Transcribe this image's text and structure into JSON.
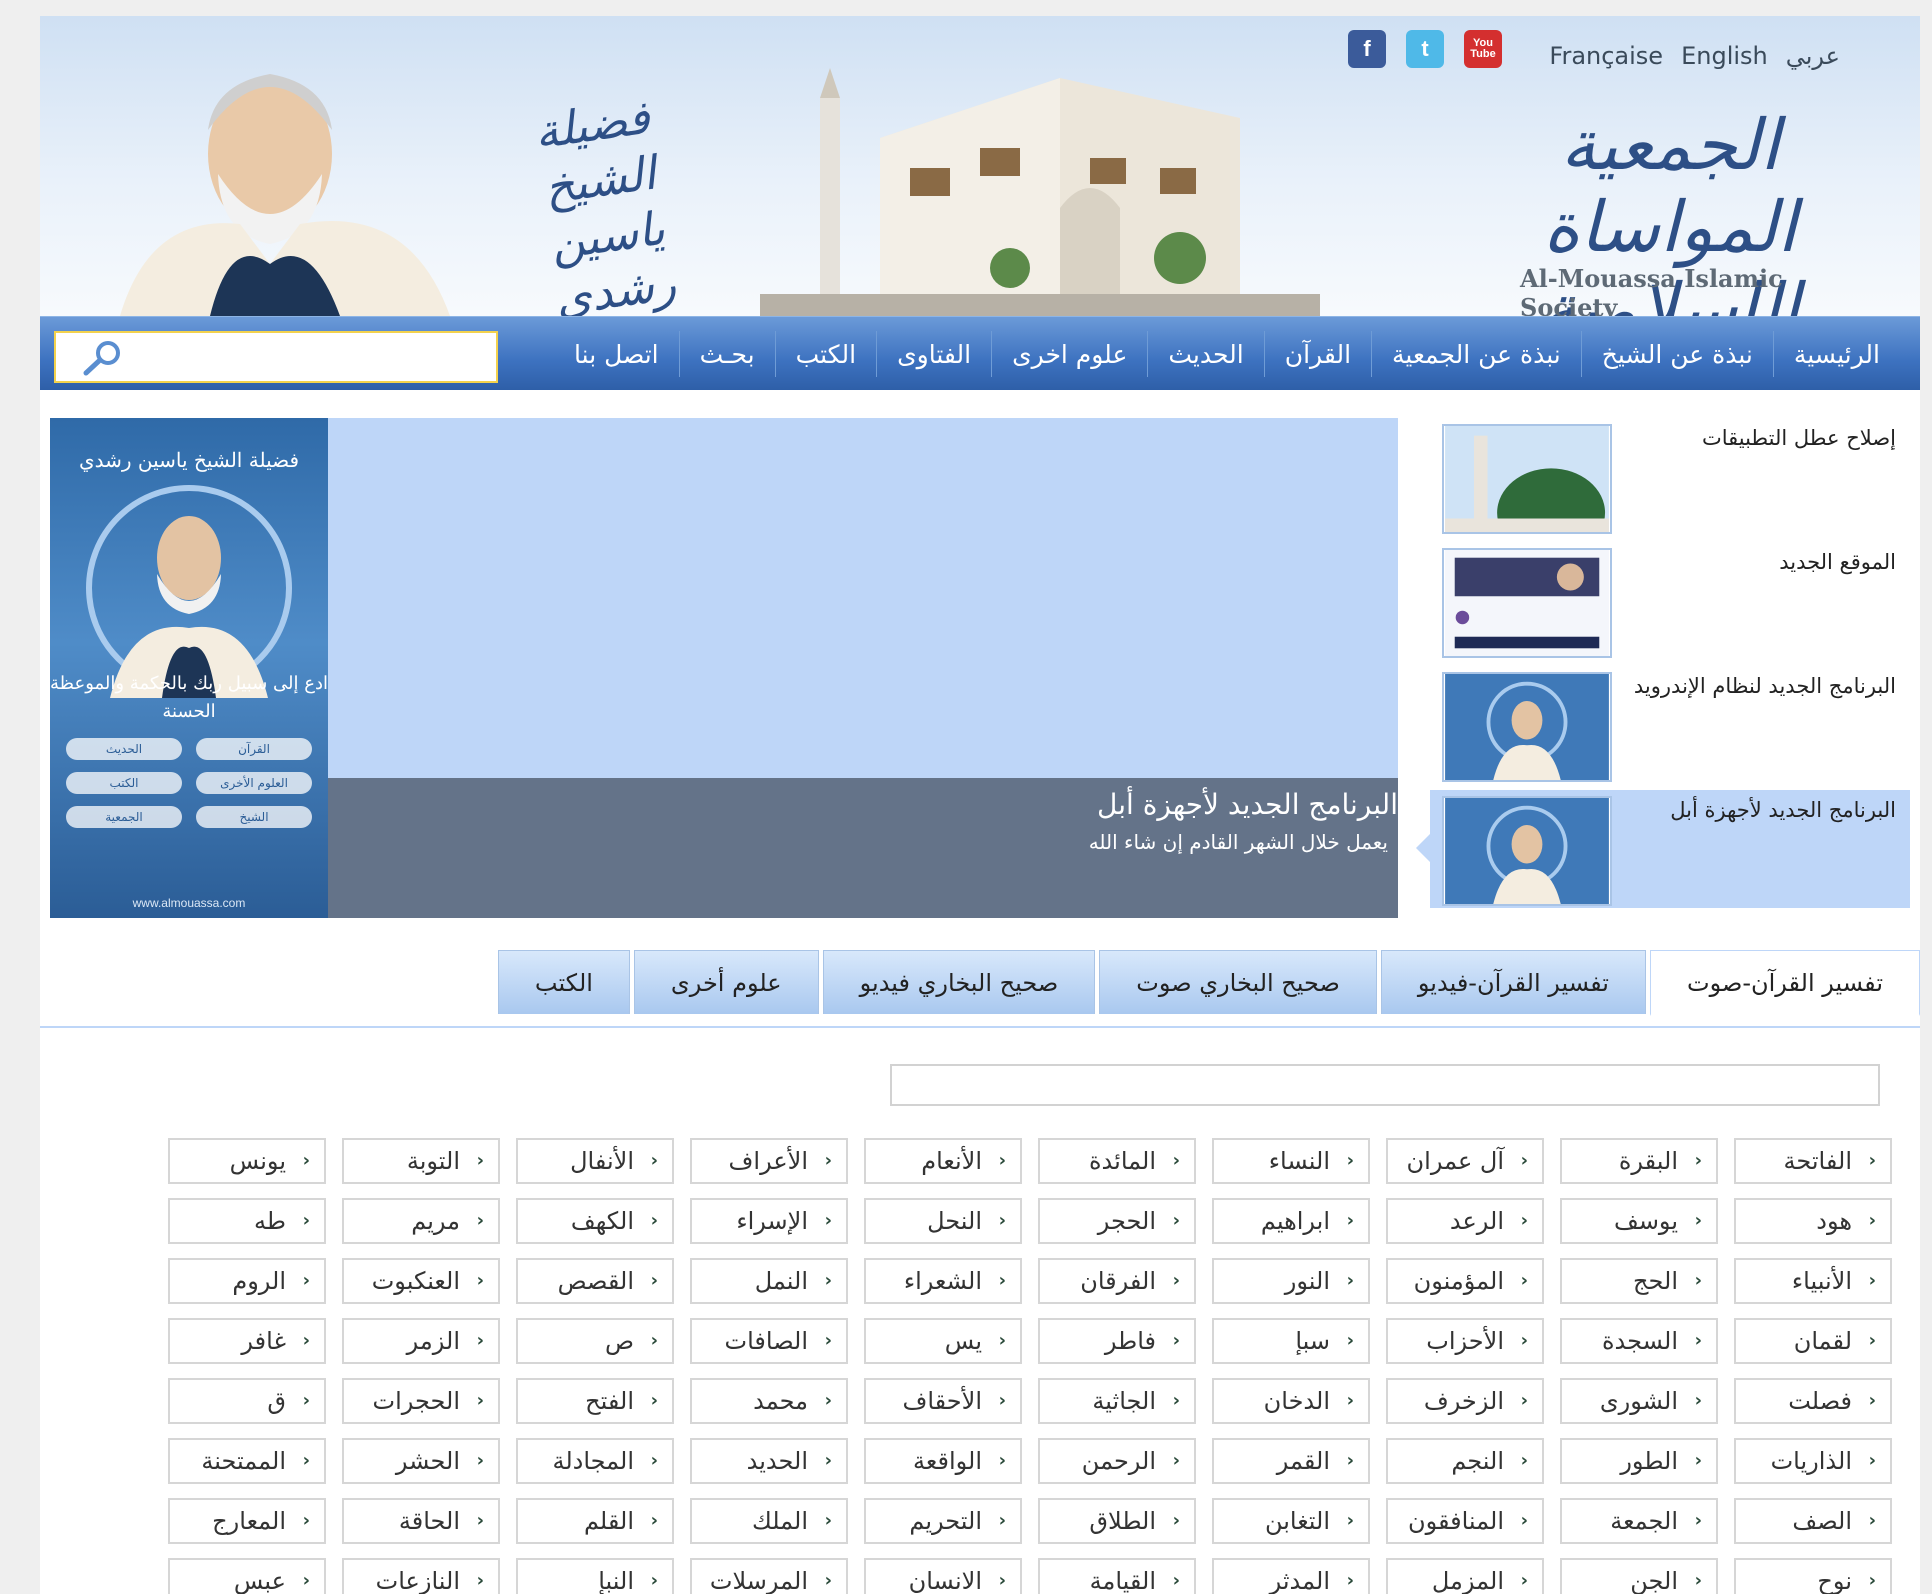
{
  "header": {
    "languages": [
      "عربي",
      "English",
      "Française"
    ],
    "social": [
      "facebook",
      "twitter",
      "youtube"
    ],
    "social_labels": {
      "facebook": "f",
      "twitter": "t",
      "youtube": "You Tube"
    },
    "society_arabic": "الجمعية المواساة الإسلامية",
    "society_latin": "Al-Mouassa Islamic Society",
    "sheikh_title": "فضيلة الشيخ ياسين رشدي"
  },
  "nav": {
    "items": [
      "الرئيسية",
      "نبذة عن الشيخ",
      "نبذة عن الجمعية",
      "القرآن",
      "الحديث",
      "علوم اخرى",
      "الفتاوى",
      "الكتب",
      "بحـث",
      "اتصل بنا"
    ],
    "search_placeholder": ""
  },
  "slider": {
    "phone": {
      "title": "فضيلة الشيخ ياسين رشدي",
      "message": "ادع إلى سبيل ربك بالحكمة والموعظة الحسنة",
      "buttons": [
        "القرآن",
        "الحديث",
        "العلوم الأخرى",
        "الكتب",
        "الشيخ",
        "الجمعية"
      ],
      "url": "www.almouassa.com"
    },
    "caption_title": "البرنامج الجديد لأجهزة أبل",
    "caption_subtitle": "يعمل خلال الشهر القادم إن شاء الله",
    "thumbs": [
      {
        "title": "إصلاح عطل التطبيقات"
      },
      {
        "title": "الموقع الجديد"
      },
      {
        "title": "البرنامج الجديد لنظام الإندرويد"
      },
      {
        "title": "البرنامج الجديد لأجهزة أبل"
      }
    ],
    "active_thumb": 3
  },
  "tabs": {
    "items": [
      "تفسير القرآن-صوت",
      "تفسير القرآن-فيديو",
      "صحيح البخاري صوت",
      "صحيح البخاري فيديو",
      "علوم أخرى",
      "الكتب"
    ],
    "active": 0,
    "filter_value": ""
  },
  "surahs": [
    "الفاتحة",
    "البقرة",
    "آل عمران",
    "النساء",
    "المائدة",
    "الأنعام",
    "الأعراف",
    "الأنفال",
    "التوبة",
    "يونس",
    "هود",
    "يوسف",
    "الرعد",
    "ابراهيم",
    "الحجر",
    "النحل",
    "الإسراء",
    "الكهف",
    "مريم",
    "طه",
    "الأنبياء",
    "الحج",
    "المؤمنون",
    "النور",
    "الفرقان",
    "الشعراء",
    "النمل",
    "القصص",
    "العنكبوت",
    "الروم",
    "لقمان",
    "السجدة",
    "الأحزاب",
    "سبإ",
    "فاطر",
    "يس",
    "الصافات",
    "ص",
    "الزمر",
    "غافر",
    "فصلت",
    "الشورى",
    "الزخرف",
    "الدخان",
    "الجاثية",
    "الأحقاف",
    "محمد",
    "الفتح",
    "الحجرات",
    "ق",
    "الذاريات",
    "الطور",
    "النجم",
    "القمر",
    "الرحمن",
    "الواقعة",
    "الحديد",
    "المجادلة",
    "الحشر",
    "الممتحنة",
    "الصف",
    "الجمعة",
    "المنافقون",
    "التغابن",
    "الطلاق",
    "التحريم",
    "الملك",
    "القلم",
    "الحاقة",
    "المعارج",
    "نوح",
    "الجن",
    "المزمل",
    "المدثر",
    "القيامة",
    "الانسان",
    "المرسلات",
    "النبإ",
    "النازعات",
    "عبس"
  ],
  "colors": {
    "nav": "#3d72c0",
    "slider_bg": "#bed6f8",
    "search_border": "#f3d24d"
  }
}
